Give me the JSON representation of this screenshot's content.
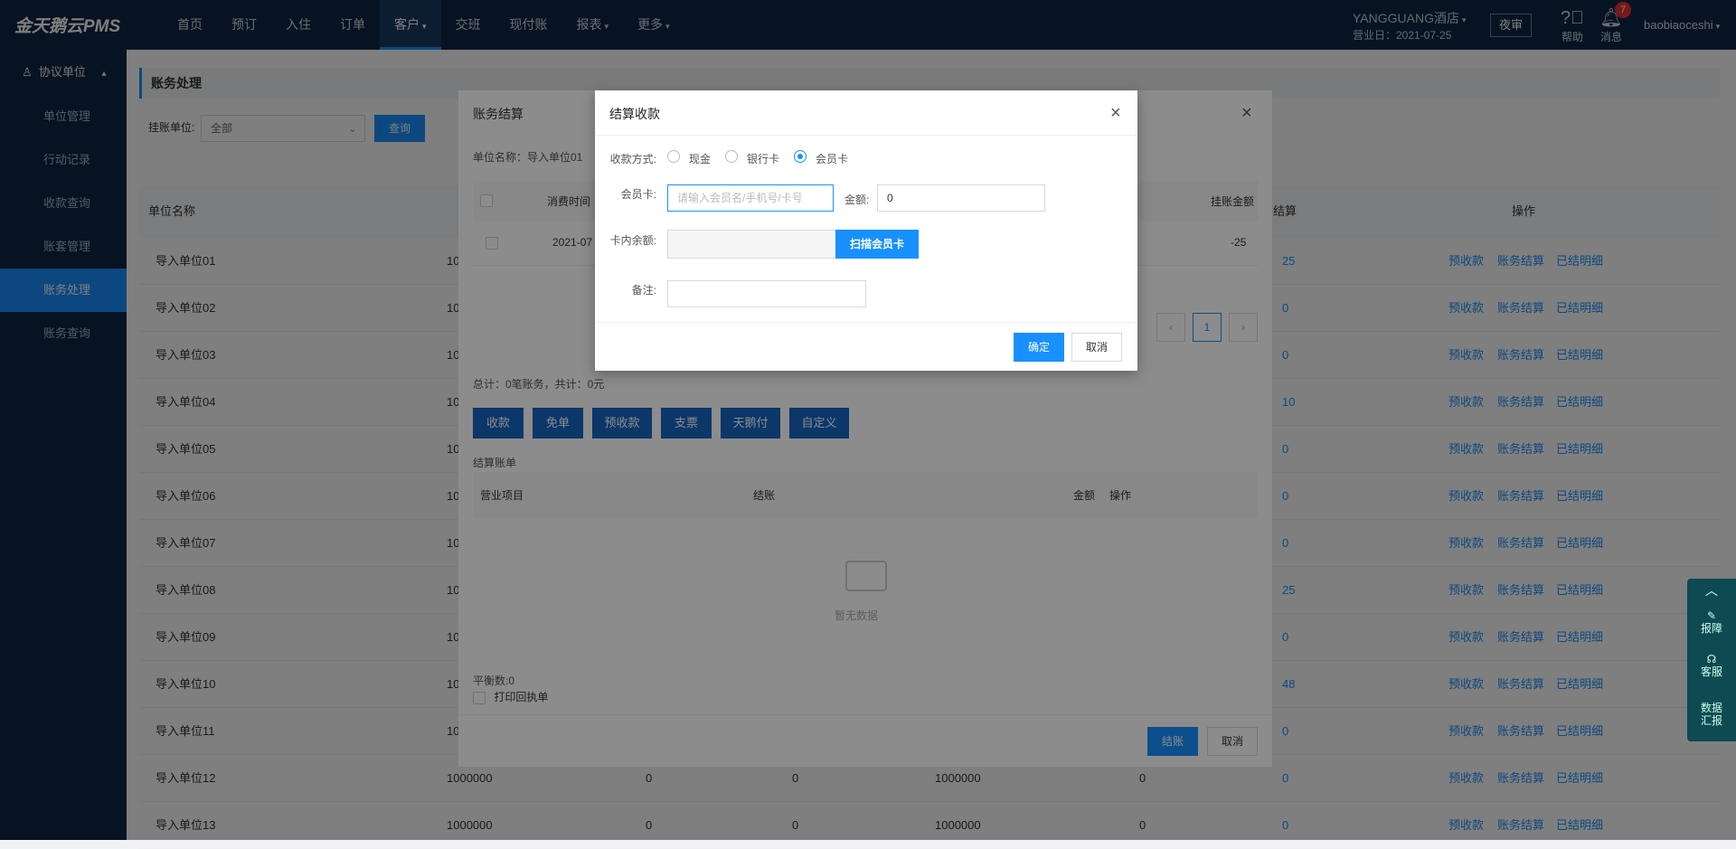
{
  "app": {
    "logo": "金天鹅云PMS"
  },
  "nav": {
    "items": [
      "首页",
      "预订",
      "入住",
      "订单",
      "客户",
      "交班",
      "现付账",
      "报表",
      "更多"
    ],
    "active_index": 4
  },
  "header": {
    "hotel": "YANGGUANG酒店",
    "business_day": "营业日：2021-07-25",
    "night_audit": "夜审",
    "help": "帮助",
    "messages": "消息",
    "message_count": "7",
    "username": "baobiaoceshi"
  },
  "sidebar": {
    "section": "协议单位",
    "items": [
      "单位管理",
      "行动记录",
      "收款查询",
      "账套管理",
      "账务处理",
      "账务查询"
    ],
    "active_index": 4
  },
  "main": {
    "title": "账务处理",
    "filter_label": "挂账单位:",
    "filter_value": "全部",
    "query_button": "查询",
    "columns": {
      "unit_name": "单位名称",
      "settle": "结算",
      "actions": "操作"
    },
    "rows": [
      {
        "name": "导入单位01",
        "c1": "10",
        "settle": "25"
      },
      {
        "name": "导入单位02",
        "c1": "10",
        "settle": "0"
      },
      {
        "name": "导入单位03",
        "c1": "10",
        "settle": "0"
      },
      {
        "name": "导入单位04",
        "c1": "10",
        "settle": "10"
      },
      {
        "name": "导入单位05",
        "c1": "10",
        "settle": "0"
      },
      {
        "name": "导入单位06",
        "c1": "10",
        "settle": "0"
      },
      {
        "name": "导入单位07",
        "c1": "10",
        "settle": "0"
      },
      {
        "name": "导入单位08",
        "c1": "10",
        "settle": "25"
      },
      {
        "name": "导入单位09",
        "c1": "10",
        "settle": "0"
      },
      {
        "name": "导入单位10",
        "c1": "10",
        "settle": "48"
      },
      {
        "name": "导入单位11",
        "c1": "10",
        "settle": "0"
      },
      {
        "name": "导入单位12",
        "c1": "1000000",
        "c2": "0",
        "c3": "0",
        "c4": "1000000",
        "c5": "0",
        "settle": "0"
      },
      {
        "name": "导入单位13",
        "c1": "1000000",
        "c2": "0",
        "c3": "0",
        "c4": "1000000",
        "c5": "0",
        "settle": "0"
      }
    ],
    "row_actions": [
      "预收款",
      "账务结算",
      "已结明细"
    ]
  },
  "account_dialog": {
    "title": "账务结算",
    "unit": "单位名称：导入单位01",
    "columns": {
      "time": "消费时间",
      "amount": "挂账金额"
    },
    "row": {
      "time": "2021-07",
      "amount": "-25"
    },
    "page": "1",
    "total": "总计：0笔账务，共计：0元",
    "actions": [
      "收款",
      "免单",
      "预收款",
      "支票",
      "天鹅付",
      "自定义"
    ],
    "bill_title": "结算账单",
    "bill_columns": {
      "item": "营业项目",
      "settle": "结账",
      "amount": "金额",
      "op": "操作"
    },
    "empty": "暂无数据",
    "balance": "平衡数:0",
    "print_receipt": "打印回执单",
    "settle_button": "结账",
    "cancel_button": "取消"
  },
  "pay_dialog": {
    "title": "结算收款",
    "method_label": "收款方式:",
    "methods": [
      "现金",
      "银行卡",
      "会员卡"
    ],
    "selected_method": 2,
    "card_label": "会员卡:",
    "card_placeholder": "请输入会员名/手机号/卡号",
    "amount_label": "金额:",
    "amount_value": "0",
    "balance_label": "卡内余额:",
    "scan_button": "扫描会员卡",
    "note_label": "备注:",
    "ok_button": "确定",
    "cancel_button": "取消"
  },
  "float_tools": {
    "items": [
      "报障",
      "客服",
      "数据汇报"
    ]
  },
  "colors": {
    "nav_bg": "#0e2744",
    "accent": "#1890ff"
  }
}
